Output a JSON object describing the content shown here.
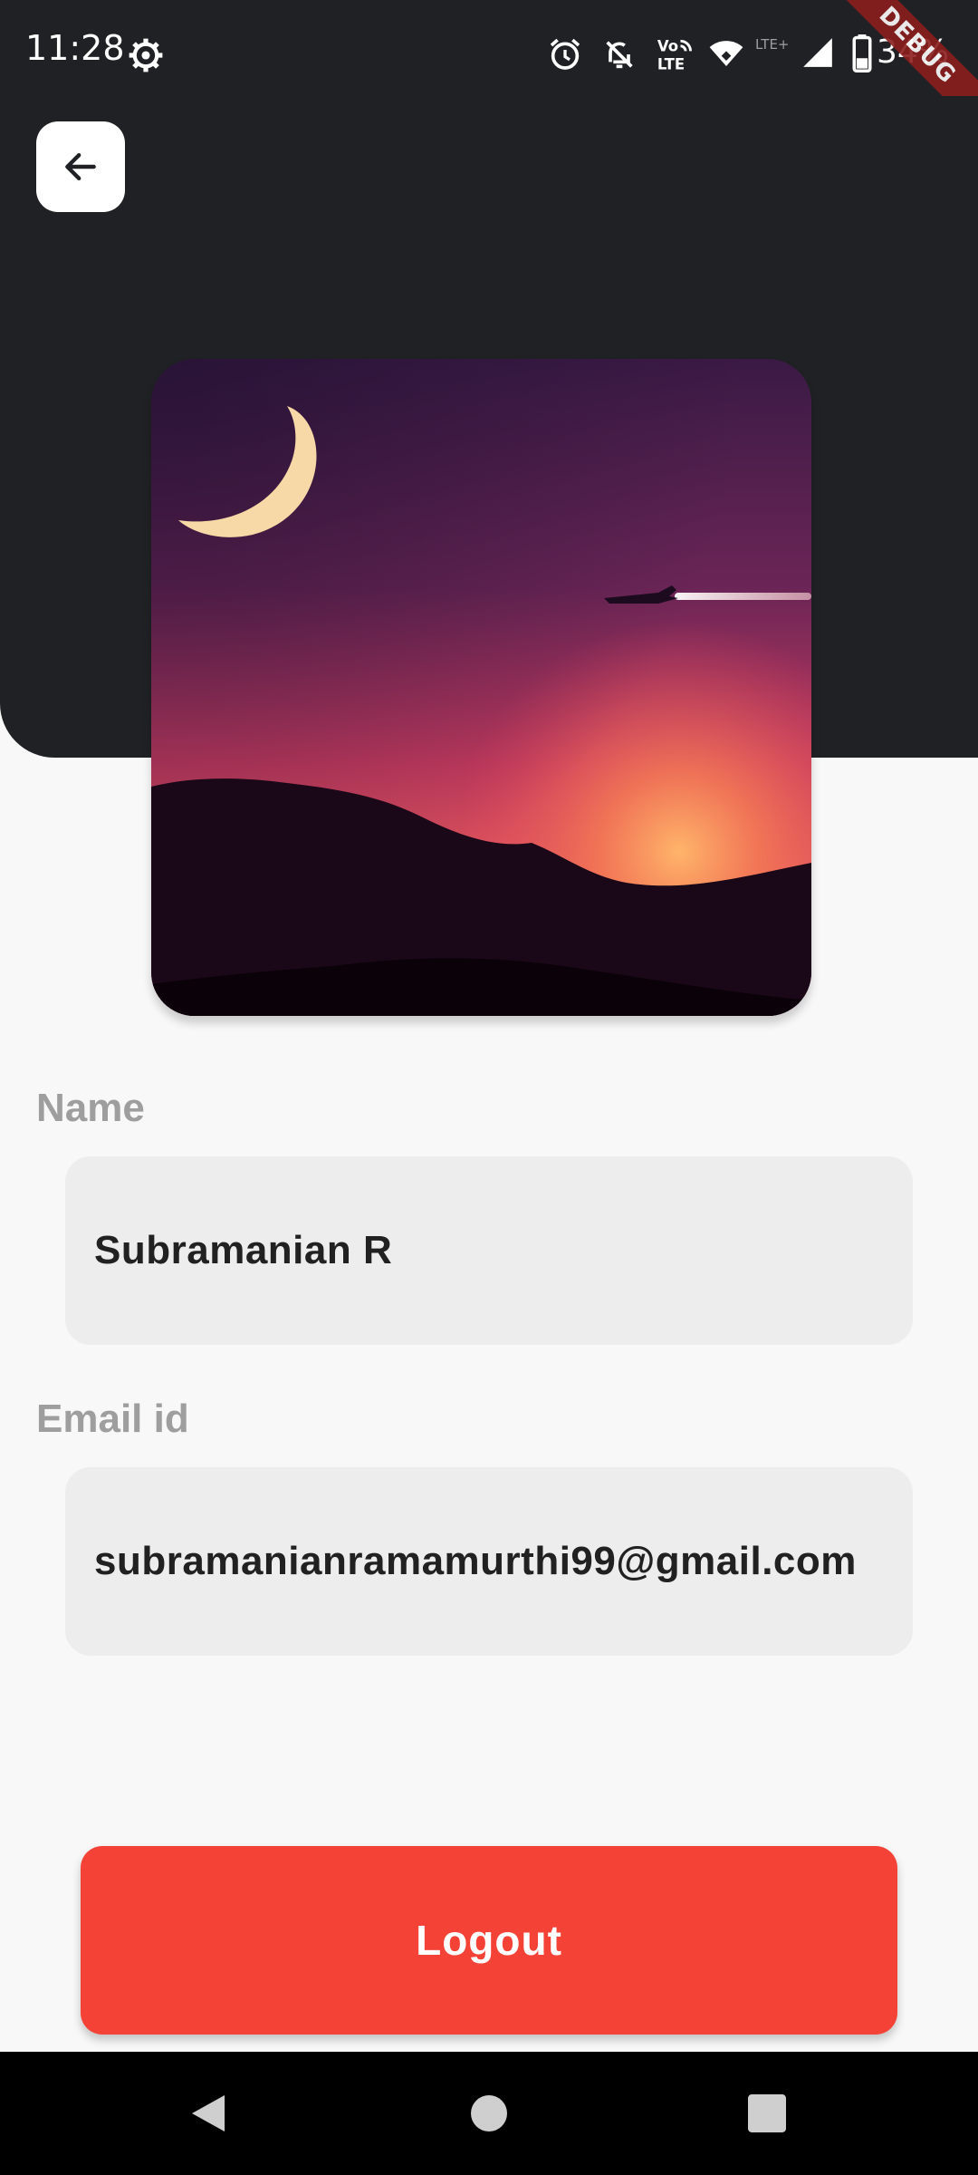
{
  "status_bar": {
    "time": "11:28",
    "battery_percent": "34%",
    "debug_badge": "DEBUG",
    "icons": [
      "settings-icon",
      "alarm-icon",
      "bell-off-icon",
      "volte-icon",
      "wifi-icon",
      "lte-plus-icon",
      "signal-icon",
      "battery-icon"
    ]
  },
  "header": {
    "back_icon": "arrow-left-icon",
    "background_color": "#202124"
  },
  "profile": {
    "image": "night-sky-sunset-with-moon-and-plane"
  },
  "fields": {
    "name": {
      "label": "Name",
      "value": "Subramanian R"
    },
    "email": {
      "label": "Email id",
      "value": "subramanianramamurthi99@gmail.com"
    }
  },
  "logout": {
    "label": "Logout",
    "color": "#f44336"
  },
  "nav_bar": {
    "icons": [
      "back-triangle-icon",
      "home-circle-icon",
      "recents-square-icon"
    ]
  }
}
